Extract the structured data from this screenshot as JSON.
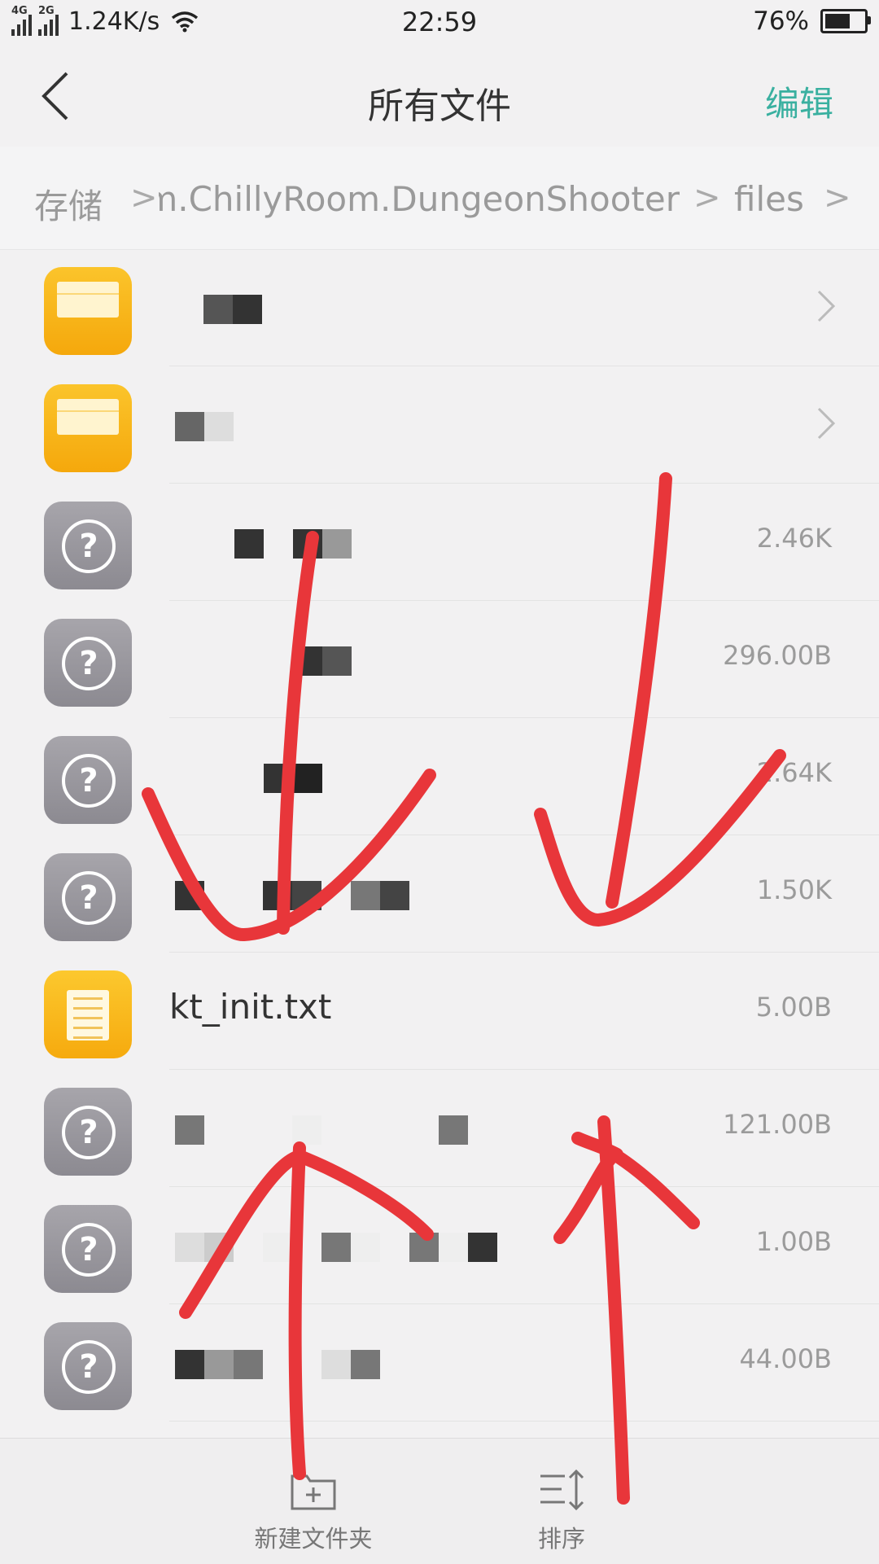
{
  "status_bar": {
    "network1": "4G",
    "network2": "2G",
    "speed": "1.24K/s",
    "time": "22:59",
    "battery_text": "76%",
    "battery_level": 0.76
  },
  "nav": {
    "title": "所有文件",
    "edit_label": "编辑",
    "accent_color": "#3ab0a0"
  },
  "breadcrumb": {
    "root": "存储",
    "path": "com.ChillyRoom.DungeonShooter",
    "current": "files",
    "sep": ">"
  },
  "files": [
    {
      "type": "folder",
      "name": "",
      "size": ""
    },
    {
      "type": "folder",
      "name": "",
      "size": ""
    },
    {
      "type": "unknown",
      "name": "",
      "size": "2.46K"
    },
    {
      "type": "unknown",
      "name": "",
      "size": "296.00B"
    },
    {
      "type": "unknown",
      "name": "",
      "size": "2.64K"
    },
    {
      "type": "unknown",
      "name": "",
      "size": "1.50K"
    },
    {
      "type": "txt",
      "name": "kt_init.txt",
      "size": "5.00B"
    },
    {
      "type": "unknown",
      "name": "",
      "size": "121.00B"
    },
    {
      "type": "unknown",
      "name": "",
      "size": "1.00B"
    },
    {
      "type": "unknown",
      "name": "",
      "size": "44.00B"
    }
  ],
  "bottom": {
    "new_folder_label": "新建文件夹",
    "sort_label": "排序"
  },
  "annotation_color": "#e8363a"
}
